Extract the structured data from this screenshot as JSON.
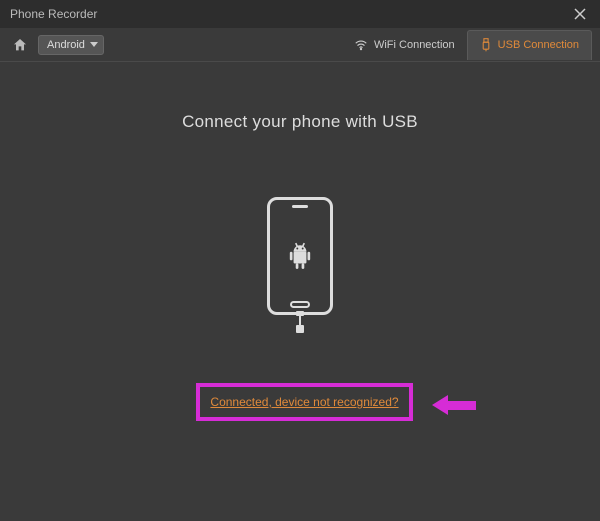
{
  "titlebar": {
    "title": "Phone Recorder"
  },
  "toolbar": {
    "os_selected": "Android",
    "wifi_tab": "WiFi Connection",
    "usb_tab": "USB Connection"
  },
  "content": {
    "heading": "Connect your phone with USB",
    "link": "Connected, device not recognized?"
  },
  "colors": {
    "accent": "#e08a3a",
    "annotation": "#d62cd6"
  }
}
